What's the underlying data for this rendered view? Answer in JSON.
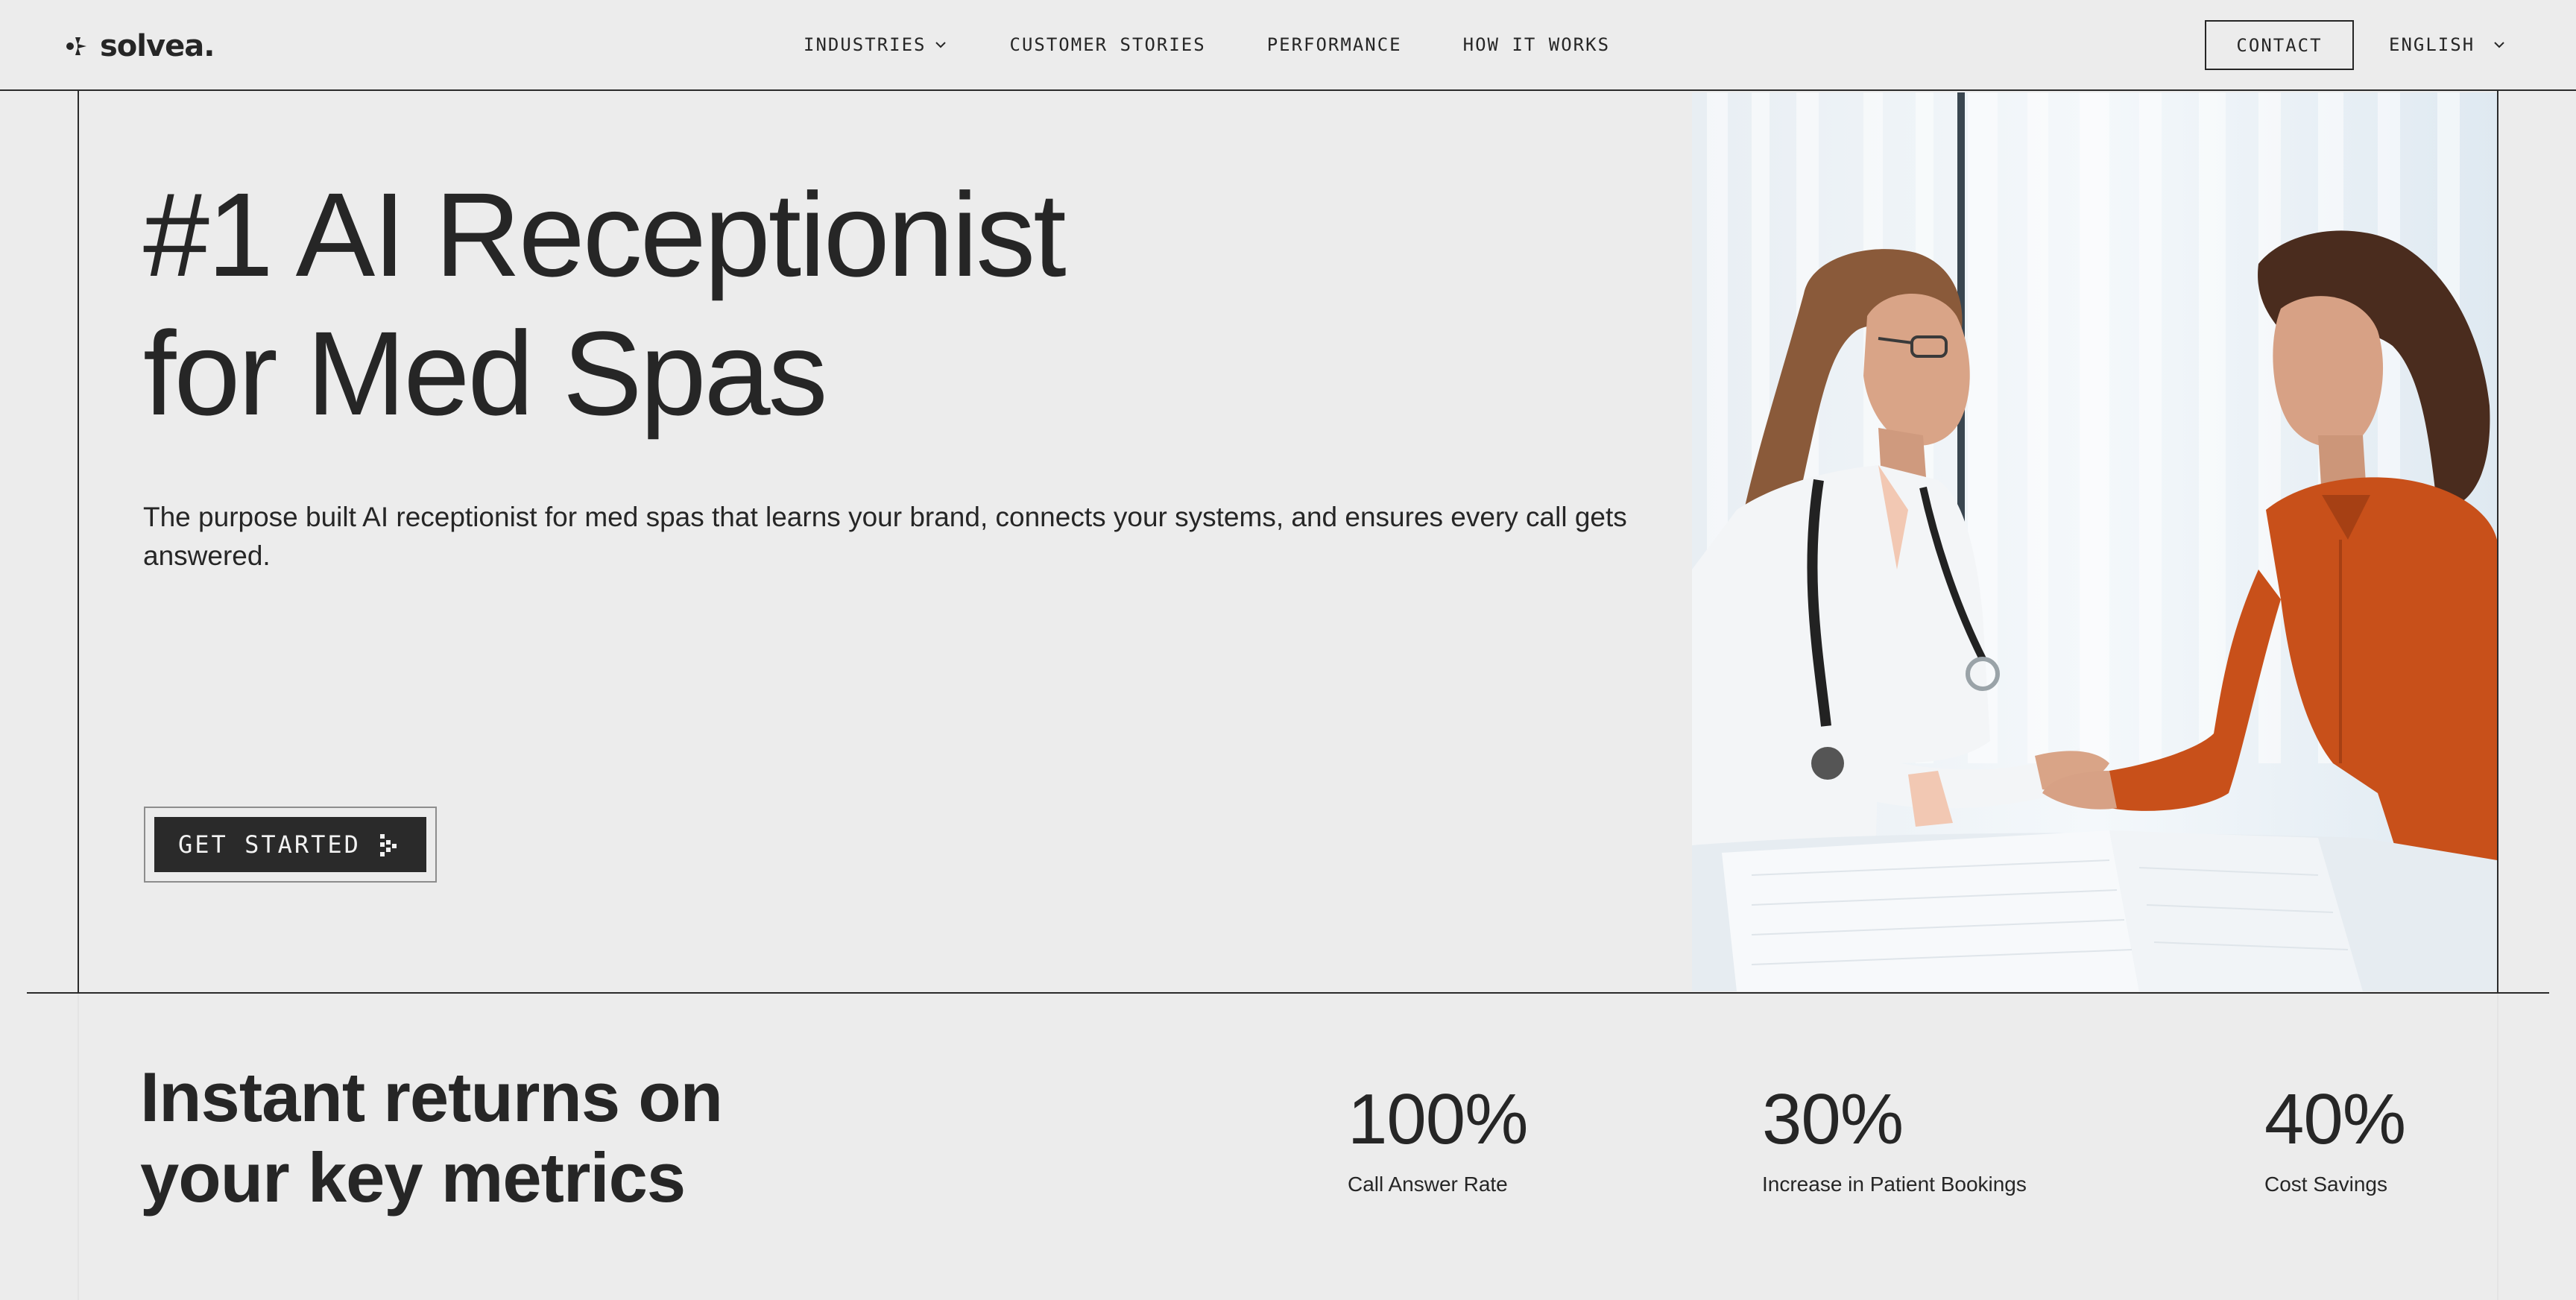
{
  "brand": {
    "name": "solvea."
  },
  "nav": {
    "links": [
      {
        "label": "INDUSTRIES",
        "has_dropdown": true
      },
      {
        "label": "CUSTOMER STORIES"
      },
      {
        "label": "PERFORMANCE"
      },
      {
        "label": "HOW IT WORKS"
      }
    ],
    "contact_label": "CONTACT",
    "language_label": "ENGLISH"
  },
  "hero": {
    "title_line1": "#1 AI Receptionist",
    "title_line2": "for Med Spas",
    "subtitle": "The purpose built AI receptionist for med spas that learns your brand, connects your systems, and ensures every call gets answered.",
    "cta_label": "GET STARTED",
    "image_icon": "doctor-patient-photo"
  },
  "metrics": {
    "title_line1": "Instant returns on",
    "title_line2": "your key metrics",
    "items": [
      {
        "value": "100%",
        "label": "Call Answer Rate"
      },
      {
        "value": "30%",
        "label": "Increase in Patient Bookings"
      },
      {
        "value": "40%",
        "label": "Cost Savings"
      }
    ]
  },
  "colors": {
    "background": "#ececec",
    "text": "#262626",
    "button_dark": "#2a2a2a",
    "shirt_orange": "#c8501a"
  }
}
